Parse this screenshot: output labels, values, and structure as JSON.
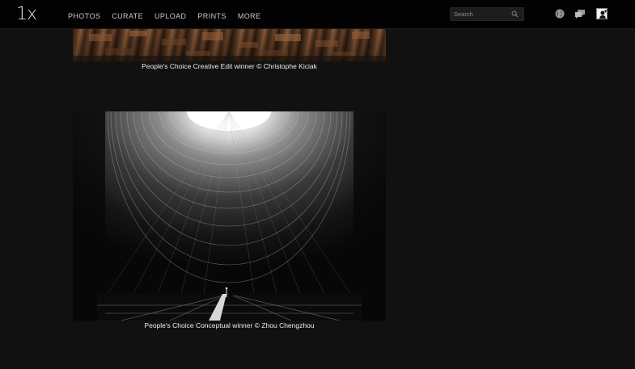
{
  "header": {
    "logo": "1x",
    "nav": [
      {
        "label": "PHOTOS"
      },
      {
        "label": "CURATE"
      },
      {
        "label": "UPLOAD"
      },
      {
        "label": "PRINTS"
      },
      {
        "label": "MORE"
      }
    ],
    "search": {
      "placeholder": "Search",
      "value": ""
    },
    "icons": [
      "search-icon",
      "globe-icon",
      "chat-icon",
      "avatar"
    ]
  },
  "content": {
    "photos": [
      {
        "caption": "People's Choice Creative Edit winner © Christophe Kiciak"
      },
      {
        "caption": "People's Choice Conceptual winner © Zhou Chengzhou"
      }
    ]
  },
  "colors": {
    "background": "#111111",
    "topbar": "#020202",
    "nav_text": "#c9c9c9",
    "caption_text": "#ececec"
  }
}
